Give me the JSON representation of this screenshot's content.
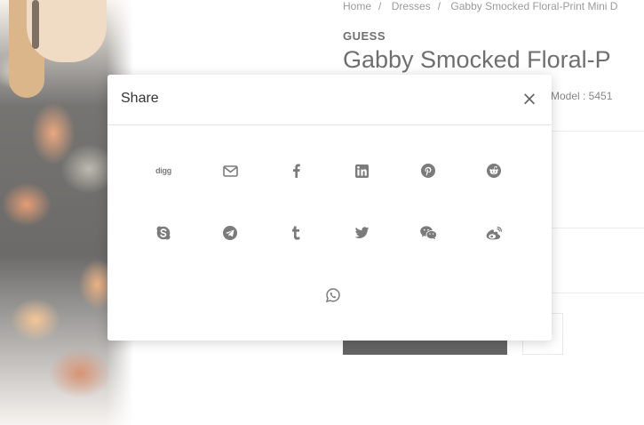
{
  "page": {
    "breadcrumb": [
      "Home",
      "Dresses",
      "Gabby Smocked Floral-Print Mini D"
    ],
    "breadcrumb_sep": "/",
    "brand": "GUESS",
    "product_title": "Gabby Smocked Floral-P",
    "model": "Model : 5451"
  },
  "modal": {
    "title": "Share",
    "close_glyph": "×",
    "icon_color": "#7b7b7b",
    "items": [
      {
        "name": "digg",
        "label": "digg"
      },
      {
        "name": "email"
      },
      {
        "name": "facebook"
      },
      {
        "name": "linkedin"
      },
      {
        "name": "pinterest"
      },
      {
        "name": "reddit"
      },
      {
        "name": "skype"
      },
      {
        "name": "telegram"
      },
      {
        "name": "tumblr"
      },
      {
        "name": "twitter"
      },
      {
        "name": "wechat"
      },
      {
        "name": "weibo"
      },
      {
        "name": "whatsapp"
      }
    ]
  }
}
